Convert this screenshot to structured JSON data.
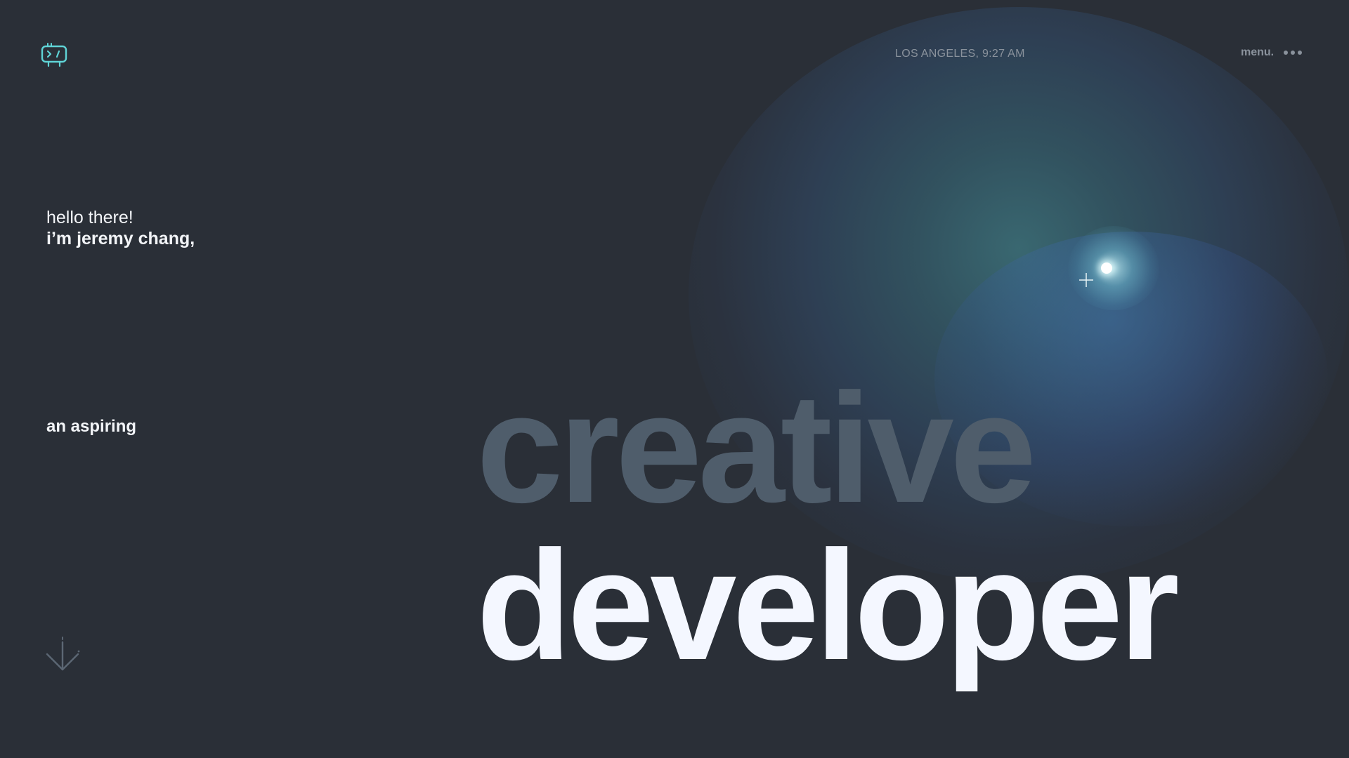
{
  "header": {
    "logo_icon": "code-monitor-icon",
    "location_time": "LOS ANGELES, 9:27 AM",
    "menu_label": "menu.",
    "menu_icon": "more-dots-icon"
  },
  "hero": {
    "greeting": "hello there!",
    "name": "i’m jeremy chang,",
    "aspiring": "an aspiring",
    "word_1": "creative",
    "word_2": "developer"
  },
  "scroll": {
    "icon": "scroll-down-arrow-icon"
  },
  "colors": {
    "background": "#2a2f37",
    "accent": "#5fd3d6",
    "muted_text": "#8a929c",
    "headline_dim": "#4f5d6b",
    "headline_bright": "#f4f7ff"
  }
}
